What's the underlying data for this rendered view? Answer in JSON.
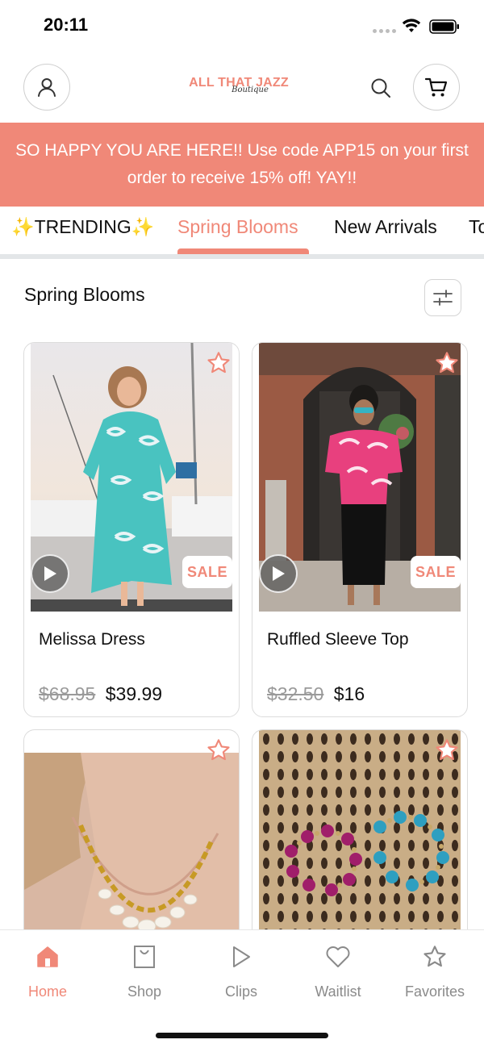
{
  "status_bar": {
    "time": "20:11"
  },
  "brand": {
    "name": "ALL THAT JAZZ",
    "tagline": "Boutique",
    "accent_color": "#f08878"
  },
  "promo": {
    "text": "SO HAPPY YOU ARE HERE!! Use code APP15 on your first order to receive 15% off! YAY!!"
  },
  "tabs": [
    {
      "label": "✨TRENDING✨",
      "selected": false
    },
    {
      "label": "Spring Blooms",
      "selected": true
    },
    {
      "label": "New Arrivals",
      "selected": false
    },
    {
      "label": "To",
      "selected": false
    }
  ],
  "section": {
    "title": "Spring Blooms"
  },
  "products": [
    {
      "name": "Melissa Dress",
      "old_price": "$68.95",
      "price": "$39.99",
      "badge": "SALE",
      "has_video": true
    },
    {
      "name": "Ruffled Sleeve Top",
      "old_price": "$32.50",
      "price": "$16",
      "badge": "SALE",
      "has_video": true
    },
    {
      "name": "",
      "old_price": "",
      "price": "",
      "badge": "",
      "has_video": false
    },
    {
      "name": "",
      "old_price": "",
      "price": "",
      "badge": "",
      "has_video": false
    }
  ],
  "bottom_nav": [
    {
      "label": "Home",
      "icon": "home-icon",
      "active": true
    },
    {
      "label": "Shop",
      "icon": "shopping-bag-icon",
      "active": false
    },
    {
      "label": "Clips",
      "icon": "play-icon",
      "active": false
    },
    {
      "label": "Waitlist",
      "icon": "heart-icon",
      "active": false
    },
    {
      "label": "Favorites",
      "icon": "star-icon",
      "active": false
    }
  ]
}
